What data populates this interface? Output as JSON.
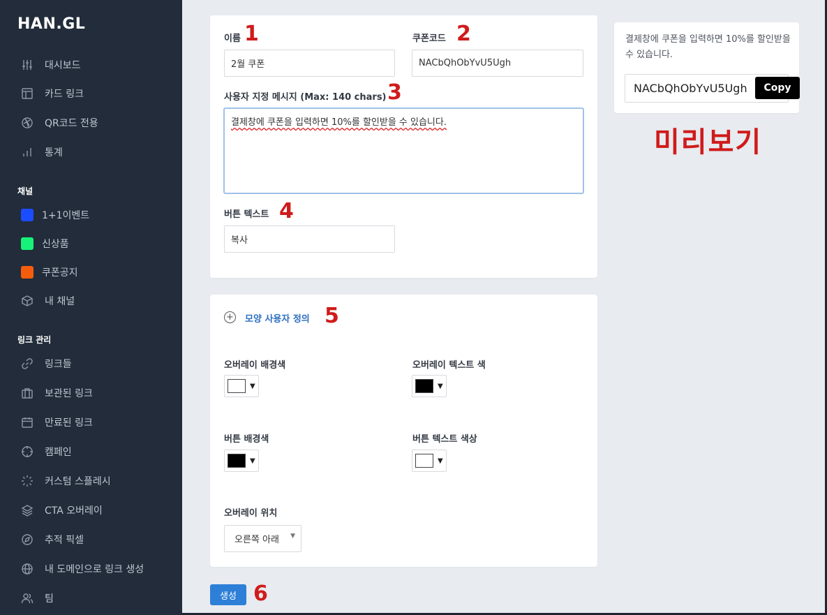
{
  "app": {
    "logo": "HAN.GL"
  },
  "sidebar": {
    "items": [
      {
        "label": "대시보드",
        "icon": "sliders-icon"
      },
      {
        "label": "카드 링크",
        "icon": "layout-icon"
      },
      {
        "label": "QR코드 전용",
        "icon": "aperture-icon"
      },
      {
        "label": "통계",
        "icon": "bar-chart-icon"
      }
    ],
    "channels_label": "채널",
    "channels": [
      {
        "label": "1+1이벤트",
        "color": "#1a4dff"
      },
      {
        "label": "신상품",
        "color": "#17f27a"
      },
      {
        "label": "쿠폰공지",
        "color": "#f55d0c"
      },
      {
        "label": "내 채널",
        "icon": "box-icon"
      }
    ],
    "links_label": "링크 관리",
    "links": [
      {
        "label": "링크들",
        "icon": "link-icon"
      },
      {
        "label": "보관된 링크",
        "icon": "briefcase-icon"
      },
      {
        "label": "만료된 링크",
        "icon": "calendar-icon"
      },
      {
        "label": "캠페인",
        "icon": "crosshair-icon"
      },
      {
        "label": "커스텀 스플레시",
        "icon": "loader-icon"
      },
      {
        "label": "CTA 오버레이",
        "icon": "layers-icon"
      },
      {
        "label": "추적 픽셀",
        "icon": "compass-icon"
      },
      {
        "label": "내 도메인으로 링크 생성",
        "icon": "globe-icon"
      },
      {
        "label": "팀",
        "icon": "users-icon"
      }
    ]
  },
  "form": {
    "name_label": "이름",
    "name_value": "2월 쿠폰",
    "coupon_label": "쿠폰코드",
    "coupon_value": "NACbQhObYvU5Ugh",
    "message_label": "사용자 지정 메시지 (Max: 140 chars)",
    "message_value": "결제창에 쿠폰을 입력하면 10%를 할인받을 수 있습니다.",
    "button_text_label": "버튼 텍스트",
    "button_text_value": "복사"
  },
  "appearance": {
    "toggle_label": "모양 사용자 정의",
    "overlay_bg_label": "오버레이 배경색",
    "overlay_bg_color": "#ffffff",
    "overlay_text_label": "오버레이 텍스트 색",
    "overlay_text_color": "#000000",
    "button_bg_label": "버튼 배경색",
    "button_bg_color": "#000000",
    "button_text_color_label": "버튼 텍스트 색상",
    "button_text_color": "#ffffff",
    "position_label": "오버레이 위치",
    "position_value": "오른쪽 아래"
  },
  "actions": {
    "create_label": "생성"
  },
  "preview": {
    "message": "결제창에 쿠폰을 입력하면 10%를 할인받을 수 있습니다.",
    "code": "NACbQhObYvU5Ugh",
    "copy_label": "Copy",
    "caption": "미리보기"
  },
  "annotations": [
    "1",
    "2",
    "3",
    "4",
    "5",
    "6"
  ]
}
